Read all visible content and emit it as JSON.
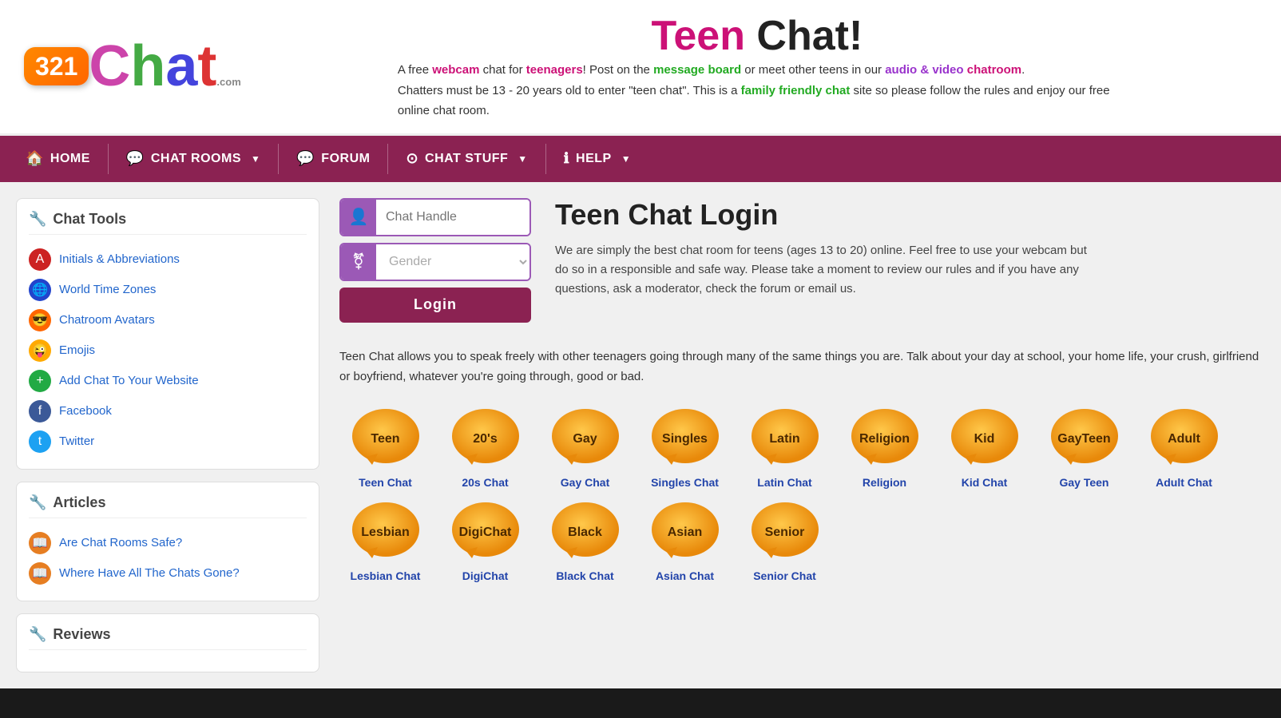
{
  "header": {
    "logo_321": "321",
    "logo_chat": "Chat",
    "logo_dot_com": ".com",
    "title_teen": "Teen",
    "title_chat": " Chat!",
    "desc_line1_pre": "A free ",
    "desc_webcam": "webcam",
    "desc_mid1": " chat for ",
    "desc_teenagers": "teenagers",
    "desc_mid2": "! Post on the ",
    "desc_message_board": "message board",
    "desc_mid3": " or meet other teens in our ",
    "desc_audio_video": "audio & video",
    "desc_chatroom": "chatroom",
    "desc_mid4": ".",
    "desc_line2_pre": "Chatters must be 13 - 20 years old to enter \"teen chat\". This is a ",
    "desc_family_friendly": "family friendly chat",
    "desc_line2_post": " site so please follow the rules and enjoy our free online chat room."
  },
  "nav": {
    "home_label": "HOME",
    "chat_rooms_label": "CHAT ROOMS",
    "forum_label": "FORUM",
    "chat_stuff_label": "CHAT STUFF",
    "help_label": "HELP"
  },
  "sidebar": {
    "chat_tools_title": "Chat Tools",
    "tools": [
      {
        "label": "Initials & Abbreviations",
        "icon": "🅰"
      },
      {
        "label": "World Time Zones",
        "icon": "🌐"
      },
      {
        "label": "Chatroom Avatars",
        "icon": "😎"
      },
      {
        "label": "Emojis",
        "icon": "😜"
      },
      {
        "label": "Add Chat To Your Website",
        "icon": "💬"
      },
      {
        "label": "Facebook",
        "icon": "f"
      },
      {
        "label": "Twitter",
        "icon": "t"
      }
    ],
    "articles_title": "Articles",
    "articles": [
      {
        "label": "Are Chat Rooms Safe?"
      },
      {
        "label": "Where Have All The Chats Gone?"
      }
    ],
    "reviews_title": "Reviews"
  },
  "login": {
    "handle_placeholder": "Chat Handle",
    "gender_placeholder": "Gender",
    "login_button": "Login",
    "title": "Teen Chat Login",
    "desc": "We are simply the best chat room for teens (ages 13 to 20) online. Feel free to use your webcam but do so in a responsible and safe way. Please take a moment to review our rules and if you have any questions, ask a moderator, check the forum or email us."
  },
  "main_desc": "Teen Chat allows you to speak freely with other teenagers going through many of the same things you are. Talk about your day at school, your home life, your crush, girlfriend or boyfriend, whatever you're going through, good or bad.",
  "chat_rooms": [
    {
      "label_bubble": "Teen",
      "label": "Teen Chat"
    },
    {
      "label_bubble": "20's",
      "label": "20s Chat"
    },
    {
      "label_bubble": "Gay",
      "label": "Gay Chat"
    },
    {
      "label_bubble": "Singles",
      "label": "Singles Chat"
    },
    {
      "label_bubble": "Latin",
      "label": "Latin Chat"
    },
    {
      "label_bubble": "Religion",
      "label": "Religion"
    },
    {
      "label_bubble": "Kid",
      "label": "Kid Chat"
    },
    {
      "label_bubble": "GayTeen",
      "label": "Gay Teen"
    },
    {
      "label_bubble": "Adult",
      "label": "Adult Chat"
    },
    {
      "label_bubble": "Lesbian",
      "label": "Lesbian Chat"
    },
    {
      "label_bubble": "DigiChat",
      "label": "DigiChat"
    },
    {
      "label_bubble": "Black",
      "label": "Black Chat"
    },
    {
      "label_bubble": "Asian",
      "label": "Asian Chat"
    },
    {
      "label_bubble": "Senior",
      "label": "Senior Chat"
    }
  ],
  "bubble_gradient_start": "#f5a623",
  "bubble_gradient_end": "#e8890a"
}
